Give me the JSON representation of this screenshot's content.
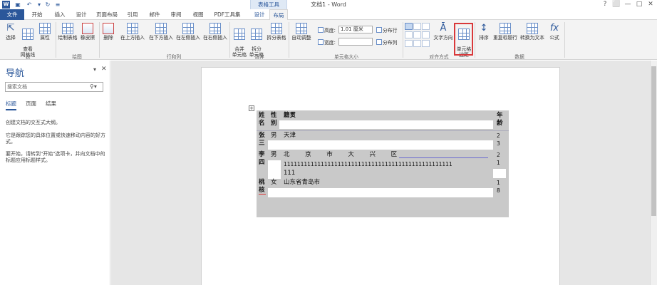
{
  "window": {
    "title": "文档1 - Word",
    "context_header": "表格工具",
    "controls": [
      "?",
      "⬜",
      "—",
      "□",
      "✕"
    ]
  },
  "tabs": [
    "文件",
    "开始",
    "插入",
    "设计",
    "页面布局",
    "引用",
    "邮件",
    "审阅",
    "视图",
    "PDF工具集",
    "设计",
    "布局"
  ],
  "ribbon": {
    "table_group": {
      "select": "选择",
      "gridlines": "查看\n网格线",
      "properties": "属性",
      "label": "表"
    },
    "draw_group": {
      "draw_table": "绘制表格",
      "eraser": "橡皮擦",
      "label": "绘图"
    },
    "delete": "删除",
    "rows_cols": {
      "insert_above": "在上方插入",
      "insert_below": "在下方插入",
      "insert_left": "在左侧插入",
      "insert_right": "在右侧插入",
      "label": "行和列"
    },
    "merge": {
      "merge_cells": "合并\n单元格",
      "split_cells": "拆分\n单元格",
      "split_table": "拆分表格",
      "label": "合并"
    },
    "cell_size": {
      "autofit": "自动调整",
      "height_label": "高度:",
      "height_value": "1.01 厘米",
      "width_label": "宽度:",
      "width_value": "",
      "distribute_rows": "分布行",
      "distribute_cols": "分布列",
      "label": "单元格大小"
    },
    "alignment": {
      "text_direction": "文字方向",
      "cell_margins": "单元格\n边距",
      "label": "对齐方式"
    },
    "data": {
      "sort": "排序",
      "repeat_header": "重复标题行",
      "convert_text": "转换为文本",
      "formula": "公式",
      "label": "数据"
    }
  },
  "nav": {
    "title": "导航",
    "search_placeholder": "搜索文档",
    "tabs": [
      "标题",
      "页面",
      "结果"
    ],
    "text1": "创建文档的交互式大纲。",
    "text2": "它是跟踪您的具体位置或快速移动内容的好方式。",
    "text3": "要开始，请转到\"开始\"选项卡，并向文档中的标题应用标题样式。"
  },
  "table": {
    "header": {
      "name": "姓\n名",
      "gender": "性\n别",
      "native": "籍贯",
      "age": "年\n龄"
    },
    "rows": [
      {
        "name": "张\n三",
        "gender": "男",
        "native": "天津",
        "age": "2\n3"
      },
      {
        "name": "李\n四",
        "gender": "男",
        "native_line1": "北        京        市        大        兴        区",
        "native_line2": "11111111111111111111111111111111111111111111111111",
        "native_line3": "111",
        "age": "2\n1"
      },
      {
        "name": "桃\n核",
        "gender": "女",
        "native": "山东省青岛市",
        "age": "1\n8"
      }
    ]
  },
  "colors": {
    "accent": "#2b579a",
    "highlight": "#d9383a",
    "table_bg": "#c9c9c9"
  }
}
